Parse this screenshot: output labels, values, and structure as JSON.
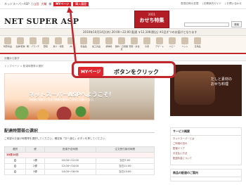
{
  "header": {
    "crumbs": [
      {
        "label": "ネットスーパーASP"
      },
      {
        "label": "| 山田"
      },
      {
        "label": "大輔"
      },
      {
        "label": "様"
      }
    ],
    "mypage_label": "MYページ",
    "cart_label": "購入履歴",
    "right_links": [
      "配達日時の変更",
      "| 初期案内ガイド",
      "| お問い合わせ"
    ],
    "logo": "NET SUPER ASP",
    "promo": {
      "year": "2011",
      "text": "おせち特集"
    },
    "search_button": "検索"
  },
  "datebar": {
    "text": "2010年10月14日(木) 20:00～22:00 配達 ￥12,106(税込) ※1品ずつのお届けとなります"
  },
  "nav": {
    "items": [
      "特売商品",
      "生鮮/乾物",
      "朝・ブランチ",
      "野菜",
      "魚介・海藻",
      "肉",
      "乳製品",
      "加工食品",
      "調味料",
      "飲料・日用雑貨",
      "惣菜・弁当",
      "冷凍",
      "デザート",
      "ベビー",
      "ペット",
      "日用品"
    ]
  },
  "subnav": "分類から探す",
  "breadcrumb": "トップページ > 配達時間帯の選択",
  "hero": {
    "headline": "ネットスーパーASPへようこそ！",
    "sub": "お時間に制限なく安全で新鮮な食材がご自宅にお届けします。"
  },
  "side_top": {
    "line1": "だしと素材の",
    "line2": "おせち料理"
  },
  "section": {
    "title": "配達時間帯の選択",
    "instruction": "ご希望のお届け時間帯を選択してください。確定後「次へ進む」ボタンを押してください。"
  },
  "table": {
    "headers": [
      "選択",
      "便",
      "配達予定時間",
      "注文受付締切時間"
    ],
    "date": "10月14日",
    "rows": [
      {
        "slot": "1便",
        "time": "10:00～12:00",
        "deadline": "当日7:00"
      },
      {
        "slot": "2便",
        "time": "12:00～14:00",
        "deadline": "当日11:00"
      },
      {
        "slot": "3便",
        "time": "14:00～16:00",
        "deadline": "当日13:00"
      }
    ]
  },
  "right_panel": {
    "title": "サービス概要",
    "links": [
      "ネットスーパーとは",
      "ご利用の流れ",
      "配達エリア",
      "お支払い方法",
      "配送料金について"
    ]
  },
  "right_panel2": {
    "title": "商品の配達のご案内"
  },
  "callout": {
    "badge": "MYページ",
    "text": "ボタンをクリック"
  }
}
